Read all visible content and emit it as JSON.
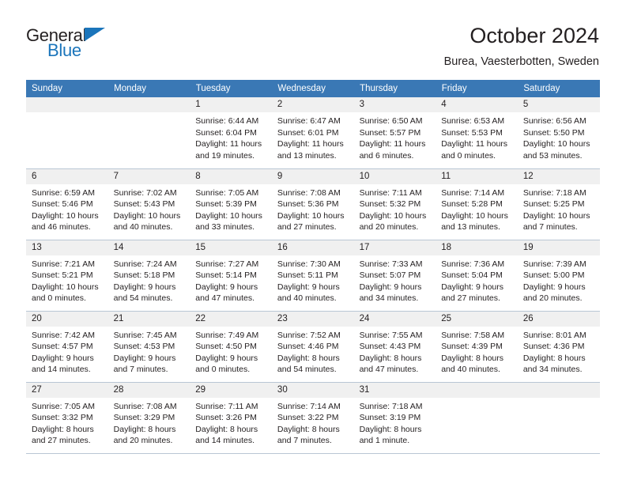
{
  "brand": {
    "word_one": "General",
    "word_two": "Blue",
    "accent_color": "#1b75bb"
  },
  "header": {
    "title": "October 2024",
    "subtitle": "Burea, Vaesterbotten, Sweden",
    "header_bg": "#3a78b5",
    "daynum_bg": "#f0f0f0"
  },
  "weekdays": [
    "Sunday",
    "Monday",
    "Tuesday",
    "Wednesday",
    "Thursday",
    "Friday",
    "Saturday"
  ],
  "labels": {
    "sunrise": "Sunrise:",
    "sunset": "Sunset:",
    "daylight": "Daylight:"
  },
  "weeks": [
    [
      {
        "day": "",
        "empty": true
      },
      {
        "day": "",
        "empty": true
      },
      {
        "day": "1",
        "sunrise": "Sunrise: 6:44 AM",
        "sunset": "Sunset: 6:04 PM",
        "daylight": "Daylight: 11 hours and 19 minutes."
      },
      {
        "day": "2",
        "sunrise": "Sunrise: 6:47 AM",
        "sunset": "Sunset: 6:01 PM",
        "daylight": "Daylight: 11 hours and 13 minutes."
      },
      {
        "day": "3",
        "sunrise": "Sunrise: 6:50 AM",
        "sunset": "Sunset: 5:57 PM",
        "daylight": "Daylight: 11 hours and 6 minutes."
      },
      {
        "day": "4",
        "sunrise": "Sunrise: 6:53 AM",
        "sunset": "Sunset: 5:53 PM",
        "daylight": "Daylight: 11 hours and 0 minutes."
      },
      {
        "day": "5",
        "sunrise": "Sunrise: 6:56 AM",
        "sunset": "Sunset: 5:50 PM",
        "daylight": "Daylight: 10 hours and 53 minutes."
      }
    ],
    [
      {
        "day": "6",
        "sunrise": "Sunrise: 6:59 AM",
        "sunset": "Sunset: 5:46 PM",
        "daylight": "Daylight: 10 hours and 46 minutes."
      },
      {
        "day": "7",
        "sunrise": "Sunrise: 7:02 AM",
        "sunset": "Sunset: 5:43 PM",
        "daylight": "Daylight: 10 hours and 40 minutes."
      },
      {
        "day": "8",
        "sunrise": "Sunrise: 7:05 AM",
        "sunset": "Sunset: 5:39 PM",
        "daylight": "Daylight: 10 hours and 33 minutes."
      },
      {
        "day": "9",
        "sunrise": "Sunrise: 7:08 AM",
        "sunset": "Sunset: 5:36 PM",
        "daylight": "Daylight: 10 hours and 27 minutes."
      },
      {
        "day": "10",
        "sunrise": "Sunrise: 7:11 AM",
        "sunset": "Sunset: 5:32 PM",
        "daylight": "Daylight: 10 hours and 20 minutes."
      },
      {
        "day": "11",
        "sunrise": "Sunrise: 7:14 AM",
        "sunset": "Sunset: 5:28 PM",
        "daylight": "Daylight: 10 hours and 13 minutes."
      },
      {
        "day": "12",
        "sunrise": "Sunrise: 7:18 AM",
        "sunset": "Sunset: 5:25 PM",
        "daylight": "Daylight: 10 hours and 7 minutes."
      }
    ],
    [
      {
        "day": "13",
        "sunrise": "Sunrise: 7:21 AM",
        "sunset": "Sunset: 5:21 PM",
        "daylight": "Daylight: 10 hours and 0 minutes."
      },
      {
        "day": "14",
        "sunrise": "Sunrise: 7:24 AM",
        "sunset": "Sunset: 5:18 PM",
        "daylight": "Daylight: 9 hours and 54 minutes."
      },
      {
        "day": "15",
        "sunrise": "Sunrise: 7:27 AM",
        "sunset": "Sunset: 5:14 PM",
        "daylight": "Daylight: 9 hours and 47 minutes."
      },
      {
        "day": "16",
        "sunrise": "Sunrise: 7:30 AM",
        "sunset": "Sunset: 5:11 PM",
        "daylight": "Daylight: 9 hours and 40 minutes."
      },
      {
        "day": "17",
        "sunrise": "Sunrise: 7:33 AM",
        "sunset": "Sunset: 5:07 PM",
        "daylight": "Daylight: 9 hours and 34 minutes."
      },
      {
        "day": "18",
        "sunrise": "Sunrise: 7:36 AM",
        "sunset": "Sunset: 5:04 PM",
        "daylight": "Daylight: 9 hours and 27 minutes."
      },
      {
        "day": "19",
        "sunrise": "Sunrise: 7:39 AM",
        "sunset": "Sunset: 5:00 PM",
        "daylight": "Daylight: 9 hours and 20 minutes."
      }
    ],
    [
      {
        "day": "20",
        "sunrise": "Sunrise: 7:42 AM",
        "sunset": "Sunset: 4:57 PM",
        "daylight": "Daylight: 9 hours and 14 minutes."
      },
      {
        "day": "21",
        "sunrise": "Sunrise: 7:45 AM",
        "sunset": "Sunset: 4:53 PM",
        "daylight": "Daylight: 9 hours and 7 minutes."
      },
      {
        "day": "22",
        "sunrise": "Sunrise: 7:49 AM",
        "sunset": "Sunset: 4:50 PM",
        "daylight": "Daylight: 9 hours and 0 minutes."
      },
      {
        "day": "23",
        "sunrise": "Sunrise: 7:52 AM",
        "sunset": "Sunset: 4:46 PM",
        "daylight": "Daylight: 8 hours and 54 minutes."
      },
      {
        "day": "24",
        "sunrise": "Sunrise: 7:55 AM",
        "sunset": "Sunset: 4:43 PM",
        "daylight": "Daylight: 8 hours and 47 minutes."
      },
      {
        "day": "25",
        "sunrise": "Sunrise: 7:58 AM",
        "sunset": "Sunset: 4:39 PM",
        "daylight": "Daylight: 8 hours and 40 minutes."
      },
      {
        "day": "26",
        "sunrise": "Sunrise: 8:01 AM",
        "sunset": "Sunset: 4:36 PM",
        "daylight": "Daylight: 8 hours and 34 minutes."
      }
    ],
    [
      {
        "day": "27",
        "sunrise": "Sunrise: 7:05 AM",
        "sunset": "Sunset: 3:32 PM",
        "daylight": "Daylight: 8 hours and 27 minutes."
      },
      {
        "day": "28",
        "sunrise": "Sunrise: 7:08 AM",
        "sunset": "Sunset: 3:29 PM",
        "daylight": "Daylight: 8 hours and 20 minutes."
      },
      {
        "day": "29",
        "sunrise": "Sunrise: 7:11 AM",
        "sunset": "Sunset: 3:26 PM",
        "daylight": "Daylight: 8 hours and 14 minutes."
      },
      {
        "day": "30",
        "sunrise": "Sunrise: 7:14 AM",
        "sunset": "Sunset: 3:22 PM",
        "daylight": "Daylight: 8 hours and 7 minutes."
      },
      {
        "day": "31",
        "sunrise": "Sunrise: 7:18 AM",
        "sunset": "Sunset: 3:19 PM",
        "daylight": "Daylight: 8 hours and 1 minute."
      },
      {
        "day": "",
        "empty": true
      },
      {
        "day": "",
        "empty": true
      }
    ]
  ]
}
